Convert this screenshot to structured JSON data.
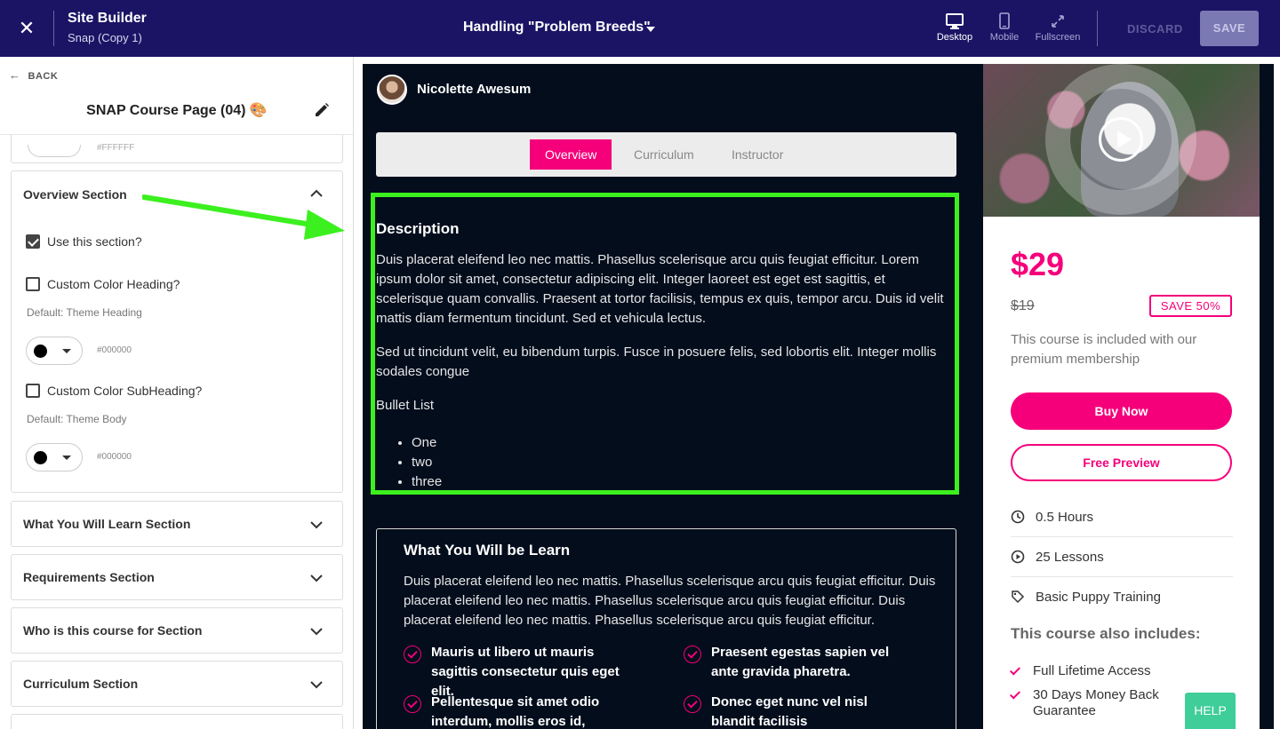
{
  "topbar": {
    "app_title": "Site Builder",
    "app_subtitle": "Snap (Copy 1)",
    "page_name": "Handling \"Problem Breeds\"",
    "views": [
      {
        "label": "Desktop",
        "icon": "desktop-icon"
      },
      {
        "label": "Mobile",
        "icon": "mobile-icon"
      },
      {
        "label": "Fullscreen",
        "icon": "fullscreen-icon"
      }
    ],
    "discard_label": "DISCARD",
    "save_label": "SAVE"
  },
  "sidebar": {
    "back_label": "BACK",
    "title": "SNAP Course Page (04) 🎨",
    "prev_hex": "#FFFFFF",
    "overview": {
      "heading": "Overview Section",
      "use_section_label": "Use this section?",
      "use_section_checked": true,
      "custom_heading_label": "Custom Color Heading?",
      "custom_heading_checked": false,
      "heading_default": "Default: Theme Heading",
      "heading_color": "#000000",
      "custom_sub_label": "Custom Color SubHeading?",
      "custom_sub_checked": false,
      "sub_default": "Default: Theme Body",
      "sub_color": "#000000"
    },
    "sections": [
      "What You Will Learn Section",
      "Requirements Section",
      "Who is this course for Section",
      "Curriculum Section"
    ]
  },
  "preview": {
    "instructor_name": "Nicolette Awesum",
    "tabs": [
      "Overview",
      "Curriculum",
      "Instructor"
    ],
    "active_tab": "Overview",
    "description": {
      "title": "Description",
      "para1": "Duis placerat eleifend leo nec mattis. Phasellus scelerisque arcu quis feugiat efficitur. Lorem ipsum dolor sit amet, consectetur adipiscing elit. Integer laoreet est eget est sagittis, et scelerisque quam convallis. Praesent at tortor facilisis, tempus ex quis, tempor arcu. Duis id velit mattis diam fermentum tincidunt. Sed et vehicula lectus.",
      "para2": "Sed ut tincidunt velit, eu bibendum turpis. Fusce in posuere felis, sed lobortis elit. Integer mollis sodales congue",
      "bullet_heading": "Bullet List",
      "bullets": [
        "One",
        "two",
        "three"
      ]
    },
    "learn": {
      "title": "What You Will be Learn",
      "para": "Duis placerat eleifend leo nec mattis. Phasellus scelerisque arcu quis feugiat efficitur. Duis placerat eleifend leo nec mattis. Phasellus scelerisque arcu quis feugiat efficitur. Duis placerat eleifend leo nec mattis. Phasellus scelerisque arcu quis feugiat efficitur.",
      "items": [
        "Mauris ut libero ut mauris sagittis consectetur quis eget elit.",
        "Praesent egestas sapien vel ante gravida pharetra.",
        "Pellentesque sit amet odio interdum, mollis eros id, tincidunt",
        "Donec eget nunc vel nisl blandit facilisis"
      ]
    },
    "card": {
      "price": "$29",
      "old_price": "$19",
      "save_badge": "SAVE 50%",
      "included_text": "This course is included with our premium membership",
      "buy_label": "Buy Now",
      "free_label": "Free Preview",
      "meta": [
        {
          "icon": "clock-icon",
          "text": "0.5 Hours"
        },
        {
          "icon": "play-circle-icon",
          "text": "25 Lessons"
        },
        {
          "icon": "tag-icon",
          "text": "Basic Puppy Training"
        }
      ],
      "includes_title": "This course also includes:",
      "includes": [
        "Full Lifetime Access",
        "30 Days Money Back Guarantee"
      ]
    }
  },
  "help_label": "HELP",
  "colors": {
    "topbar": "#1b1464",
    "accent": "#f5007a",
    "highlight": "#3cf01f",
    "dark_bg": "#030d1c",
    "help": "#3fcd9a"
  }
}
